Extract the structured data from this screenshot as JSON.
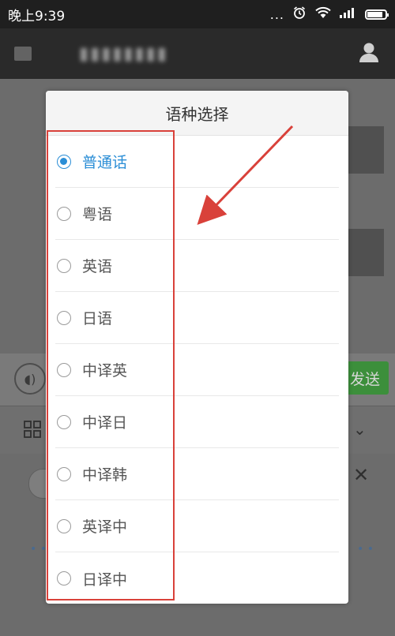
{
  "status_bar": {
    "time": "晚上9:39",
    "dots": "...",
    "alarm_icon": "alarm-icon",
    "wifi_icon": "wifi-icon",
    "signal_icon": "signal-icon",
    "battery_icon": "battery-icon"
  },
  "header": {
    "back_icon": "back-icon",
    "avatar_icon": "person-icon"
  },
  "background": {
    "send_label": "发送",
    "voice_icon": "voice-icon",
    "grid_icon": "grid-icon",
    "chevron_icon": "chevron-down-icon",
    "close_icon": "close-icon"
  },
  "dialog": {
    "title": "语种选择",
    "options": [
      {
        "label": "普通话",
        "selected": true
      },
      {
        "label": "粤语",
        "selected": false
      },
      {
        "label": "英语",
        "selected": false
      },
      {
        "label": "日语",
        "selected": false
      },
      {
        "label": "中译英",
        "selected": false
      },
      {
        "label": "中译日",
        "selected": false
      },
      {
        "label": "中译韩",
        "selected": false
      },
      {
        "label": "英译中",
        "selected": false
      },
      {
        "label": "日译中",
        "selected": false
      }
    ]
  },
  "colors": {
    "accent": "#2b8ed6",
    "annotation": "#d9413a",
    "send_button": "#3c8f3b"
  }
}
